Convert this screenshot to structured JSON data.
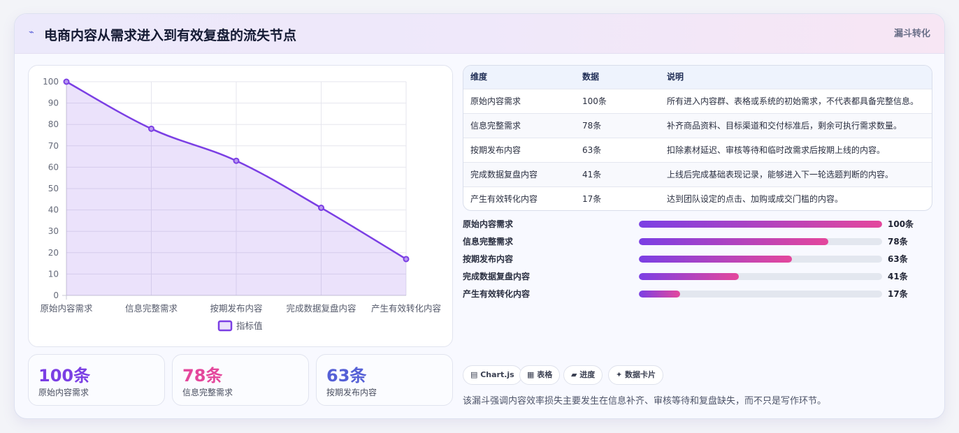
{
  "header": {
    "icon": "chart-line-icon",
    "icon_glyph": "⌁",
    "title": "电商内容从需求进入到有效复盘的流失节点",
    "tag": "漏斗转化"
  },
  "colors": {
    "accent_purple": "#7b3fe4",
    "accent_pink": "#e4479c",
    "accent_blue": "#5560d6"
  },
  "chart_data": {
    "type": "line",
    "categories": [
      "原始内容需求",
      "信息完整需求",
      "按期发布内容",
      "完成数据复盘内容",
      "产生有效转化内容"
    ],
    "series": [
      {
        "name": "指标值",
        "values": [
          100,
          78,
          63,
          41,
          17
        ]
      }
    ],
    "ylim": [
      0,
      100
    ],
    "yticks": [
      0,
      10,
      20,
      30,
      40,
      50,
      60,
      70,
      80,
      90,
      100
    ],
    "area_fill": true,
    "grid": true,
    "legend": "bottom"
  },
  "stats": [
    {
      "value": "100条",
      "label": "原始内容需求",
      "color": "#7b3fe4"
    },
    {
      "value": "78条",
      "label": "信息完整需求",
      "color": "#e4479c"
    },
    {
      "value": "63条",
      "label": "按期发布内容",
      "color": "#5560d6"
    }
  ],
  "table": {
    "headers": [
      "维度",
      "数据",
      "说明"
    ],
    "rows": [
      [
        "原始内容需求",
        "100条",
        "所有进入内容群、表格或系统的初始需求，不代表都具备完整信息。"
      ],
      [
        "信息完整需求",
        "78条",
        "补齐商品资料、目标渠道和交付标准后，剩余可执行需求数量。"
      ],
      [
        "按期发布内容",
        "63条",
        "扣除素材延迟、审核等待和临时改需求后按期上线的内容。"
      ],
      [
        "完成数据复盘内容",
        "41条",
        "上线后完成基础表现记录，能够进入下一轮选题判断的内容。"
      ],
      [
        "产生有效转化内容",
        "17条",
        "达到团队设定的点击、加购或成交门槛的内容。"
      ]
    ]
  },
  "progress": [
    {
      "label": "原始内容需求",
      "value": "100条",
      "fraction": 1.0
    },
    {
      "label": "信息完整需求",
      "value": "78条",
      "fraction": 0.78
    },
    {
      "label": "按期发布内容",
      "value": "63条",
      "fraction": 0.63
    },
    {
      "label": "完成数据复盘内容",
      "value": "41条",
      "fraction": 0.41
    },
    {
      "label": "产生有效转化内容",
      "value": "17条",
      "fraction": 0.17
    }
  ],
  "chips": [
    {
      "icon": "chart-icon",
      "label": "▤ Chart.js"
    },
    {
      "icon": "table-icon",
      "label": "▦ 表格"
    },
    {
      "icon": "progress-icon",
      "label": "▰ 进度"
    },
    {
      "icon": "sparkle-icon",
      "label": "✦ 数据卡片"
    }
  ],
  "note": "该漏斗强调内容效率损失主要发生在信息补齐、审核等待和复盘缺失，而不只是写作环节。"
}
